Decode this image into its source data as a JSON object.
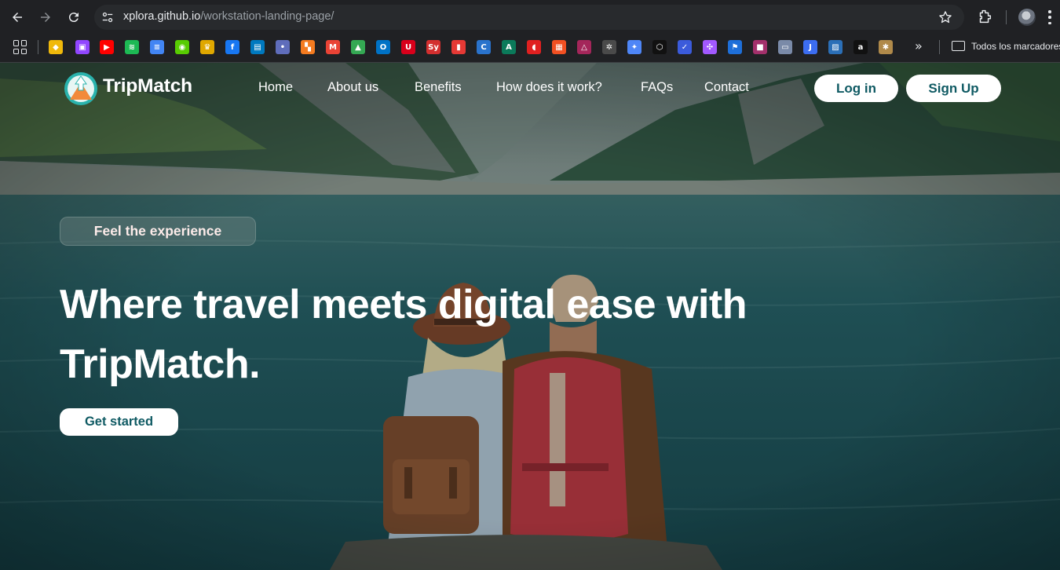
{
  "browser": {
    "url_host": "xplora.github.io",
    "url_path": "/workstation-landing-page/",
    "bookmarks_folder_label": "Todos los marcadores",
    "bookmarks_overflow": "»"
  },
  "bookmarks": [
    {
      "name": "binance-icon",
      "glyph": "◆",
      "color": "#f0b90b"
    },
    {
      "name": "twitch-icon",
      "glyph": "▣",
      "color": "#9146ff"
    },
    {
      "name": "youtube-icon",
      "glyph": "▶",
      "color": "#ff0000"
    },
    {
      "name": "spotify-icon",
      "glyph": "≋",
      "color": "#1db954"
    },
    {
      "name": "google-docs-icon",
      "glyph": "≡",
      "color": "#4285f4"
    },
    {
      "name": "duolingo-icon",
      "glyph": "◉",
      "color": "#58cc02"
    },
    {
      "name": "crown-icon",
      "glyph": "♛",
      "color": "#e0a800"
    },
    {
      "name": "facebook-icon",
      "glyph": "f",
      "color": "#1877f2"
    },
    {
      "name": "trello-icon",
      "glyph": "▤",
      "color": "#0079bf"
    },
    {
      "name": "dot-icon",
      "glyph": "•",
      "color": "#5f6dbb"
    },
    {
      "name": "blocks-icon",
      "glyph": "▚",
      "color": "#f47b20"
    },
    {
      "name": "gmail-icon",
      "glyph": "M",
      "color": "#ea4335"
    },
    {
      "name": "google-drive-icon",
      "glyph": "▲",
      "color": "#34a853"
    },
    {
      "name": "outlook-icon",
      "glyph": "O",
      "color": "#0072c6"
    },
    {
      "name": "university-icon",
      "glyph": "U",
      "color": "#d9001b"
    },
    {
      "name": "symbolab-icon",
      "glyph": "Sy",
      "color": "#d32f2f"
    },
    {
      "name": "book-icon",
      "glyph": "▮",
      "color": "#e53935"
    },
    {
      "name": "coursera-icon",
      "glyph": "C",
      "color": "#2a73cc"
    },
    {
      "name": "app-a-icon",
      "glyph": "A",
      "color": "#0b7a5a"
    },
    {
      "name": "flame-icon",
      "glyph": "◖",
      "color": "#e02020"
    },
    {
      "name": "microsoft-icon",
      "glyph": "▦",
      "color": "#f25022"
    },
    {
      "name": "triangle-app-icon",
      "glyph": "△",
      "color": "#a4265a"
    },
    {
      "name": "openai-icon",
      "glyph": "✲",
      "color": "#4a4a4a"
    },
    {
      "name": "gemini-icon",
      "glyph": "✦",
      "color": "#4e86f7"
    },
    {
      "name": "hexagon-icon",
      "glyph": "⬡",
      "color": "#111111"
    },
    {
      "name": "check-app-icon",
      "glyph": "✓",
      "color": "#3b5bdb"
    },
    {
      "name": "figma-icon",
      "glyph": "✣",
      "color": "#a259ff"
    },
    {
      "name": "flag-icon",
      "glyph": "⚑",
      "color": "#1e6fd9"
    },
    {
      "name": "square-app-icon",
      "glyph": "■",
      "color": "#a3306b"
    },
    {
      "name": "card-icon",
      "glyph": "▭",
      "color": "#7a8aa8"
    },
    {
      "name": "j-app-icon",
      "glyph": "J",
      "color": "#3c6df0"
    },
    {
      "name": "image-icon",
      "glyph": "▨",
      "color": "#2b6fb7"
    },
    {
      "name": "amazon-icon",
      "glyph": "a",
      "color": "#111111"
    },
    {
      "name": "puzzle-app-icon",
      "glyph": "✱",
      "color": "#b08a4a"
    }
  ],
  "site": {
    "logo_text": "TripMatch",
    "nav": [
      "Home",
      "About us",
      "Benefits",
      "How does it work?",
      "FAQs",
      "Contact"
    ],
    "login_label": "Log in",
    "signup_label": "Sign Up",
    "tagline": "Feel the experience",
    "headline_line1": "Where travel meets digital ease with",
    "headline_line2": "TripMatch.",
    "cta_label": "Get started",
    "accent_color": "#0f5a63"
  }
}
